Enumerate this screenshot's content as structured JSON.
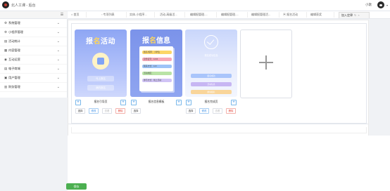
{
  "header": {
    "app_title": "北人工课 - 后台",
    "user_name": "小歌",
    "caret": "▾"
  },
  "sidebar": {
    "collapse_glyph": "☰",
    "items": [
      {
        "label": "系统管理",
        "icon": "gear-icon",
        "glyph": "⚙"
      },
      {
        "label": "小程序管理",
        "icon": "gear-icon",
        "glyph": "⚙"
      },
      {
        "label": "活动统计",
        "icon": "chart-icon",
        "glyph": "▤"
      },
      {
        "label": "内容管理",
        "icon": "doc-icon",
        "glyph": "▦"
      },
      {
        "label": "互动运营",
        "icon": "eye-icon",
        "glyph": "◉"
      },
      {
        "label": "电子商城",
        "icon": "list-icon",
        "glyph": "▤"
      },
      {
        "label": "用户管理",
        "icon": "user-icon",
        "glyph": "▣"
      },
      {
        "label": "财务管理",
        "icon": "wallet-icon",
        "glyph": "▥"
      }
    ]
  },
  "tabs": [
    {
      "label": "首页",
      "icon": "home-icon"
    },
    {
      "label": "专项列表"
    },
    {
      "label": "实体-小程序..."
    },
    {
      "label": "活动-高级活..."
    },
    {
      "label": "编辑报管理-..."
    },
    {
      "label": "编辑报管理-..."
    },
    {
      "label": "编辑报管理活..."
    },
    {
      "label": "报名活动"
    },
    {
      "label": "编辑获奖"
    },
    {
      "label": "加入定律",
      "active": true,
      "close": "×",
      "refresh": "↻"
    }
  ],
  "cards": {
    "card1": {
      "title_a": "报",
      "title_hl": "名",
      "title_b": "活动",
      "btn1": "马上报名",
      "btn2": "我的报名"
    },
    "card2": {
      "title_a": "报",
      "title_hl": "名",
      "title_b": "信息",
      "rows": [
        "姓名/昵称：小学生",
        "身份证号：1234",
        "联系方式：123",
        "活动地区：",
        "参与方式：线上活动"
      ],
      "colors": [
        "#fcd667",
        "#f7a8b8",
        "#9dc3f7",
        "#b9e3a6",
        "#d0c3f5"
      ]
    },
    "card3": {
      "done_text": "报名成功信息",
      "bars": [
        "报名成功",
        "活动信息",
        "继续报名"
      ],
      "bar_colors": [
        "#a9c5fb",
        "#c7b6f3",
        "#f9d59a"
      ]
    }
  },
  "labels": {
    "card1": "报名引导页",
    "card2": "报名信息模板",
    "card3": "报名完成页"
  },
  "actions": {
    "select": "选择",
    "edit": "修改",
    "view": "查看",
    "delete": "删除"
  },
  "plus": "+",
  "save_button": "保存"
}
